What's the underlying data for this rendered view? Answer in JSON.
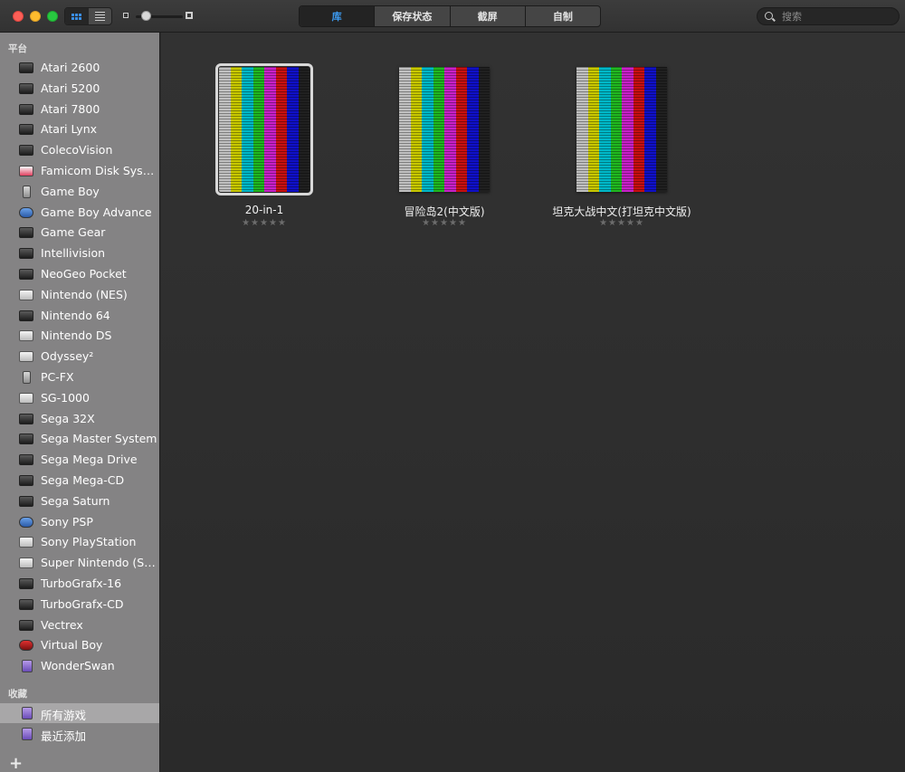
{
  "toolbar": {
    "view_modes": [
      "grid-view",
      "list-view"
    ],
    "tabs": [
      {
        "label": "库",
        "active": true
      },
      {
        "label": "保存状态",
        "active": false
      },
      {
        "label": "截屏",
        "active": false
      },
      {
        "label": "自制",
        "active": false
      }
    ],
    "search_placeholder": "搜索",
    "zoom_level": 0.15
  },
  "sidebar": {
    "platform_header": "平台",
    "platforms": [
      {
        "label": "Atari 2600",
        "icon": "console"
      },
      {
        "label": "Atari 5200",
        "icon": "console"
      },
      {
        "label": "Atari 7800",
        "icon": "console"
      },
      {
        "label": "Atari Lynx",
        "icon": "console"
      },
      {
        "label": "ColecoVision",
        "icon": "console"
      },
      {
        "label": "Famicom Disk System",
        "icon": "pink"
      },
      {
        "label": "Game Boy",
        "icon": "handheld"
      },
      {
        "label": "Game Boy Advance",
        "icon": "blue"
      },
      {
        "label": "Game Gear",
        "icon": "console"
      },
      {
        "label": "Intellivision",
        "icon": "console"
      },
      {
        "label": "NeoGeo Pocket",
        "icon": "console"
      },
      {
        "label": "Nintendo (NES)",
        "icon": "white"
      },
      {
        "label": "Nintendo 64",
        "icon": "console"
      },
      {
        "label": "Nintendo DS",
        "icon": "white"
      },
      {
        "label": "Odyssey²",
        "icon": "white"
      },
      {
        "label": "PC-FX",
        "icon": "handheld"
      },
      {
        "label": "SG-1000",
        "icon": "white"
      },
      {
        "label": "Sega 32X",
        "icon": "console"
      },
      {
        "label": "Sega Master System",
        "icon": "console"
      },
      {
        "label": "Sega Mega Drive",
        "icon": "console"
      },
      {
        "label": "Sega Mega-CD",
        "icon": "console"
      },
      {
        "label": "Sega Saturn",
        "icon": "console"
      },
      {
        "label": "Sony PSP",
        "icon": "blue"
      },
      {
        "label": "Sony PlayStation",
        "icon": "white"
      },
      {
        "label": "Super Nintendo (SNES)",
        "icon": "white"
      },
      {
        "label": "TurboGrafx-16",
        "icon": "console"
      },
      {
        "label": "TurboGrafx-CD",
        "icon": "console"
      },
      {
        "label": "Vectrex",
        "icon": "console"
      },
      {
        "label": "Virtual Boy",
        "icon": "red"
      },
      {
        "label": "WonderSwan",
        "icon": "purple"
      }
    ],
    "collections_header": "收藏",
    "collections": [
      {
        "label": "所有游戏",
        "selected": true
      },
      {
        "label": "最近添加",
        "selected": false
      }
    ],
    "add_button": "+"
  },
  "games": [
    {
      "title": "20-in-1",
      "rating": "★★★★★",
      "selected": true
    },
    {
      "title": "冒险岛2(中文版)",
      "rating": "★★★★★",
      "selected": false
    },
    {
      "title": "坦克大战中文(打坦克中文版)",
      "rating": "★★★★★",
      "selected": false
    }
  ],
  "colors": {
    "accent": "#3c9af0",
    "bars": [
      "#c0c0c0",
      "#c8c800",
      "#00b8c8",
      "#20b820",
      "#c820c8",
      "#c81010",
      "#1010c8",
      "#202020"
    ]
  }
}
